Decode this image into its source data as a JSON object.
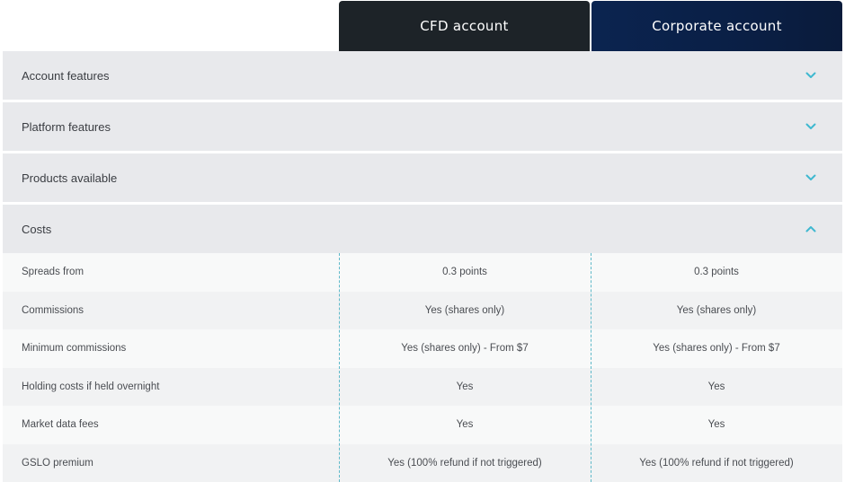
{
  "columns": [
    {
      "label": "CFD account",
      "color": "#1d2328"
    },
    {
      "label": "Corporate account",
      "color": "#0b2450"
    }
  ],
  "accent_color": "#3fb8d0",
  "sections": [
    {
      "label": "Account features",
      "expanded": false,
      "icon": "chevron-down-icon"
    },
    {
      "label": "Platform features",
      "expanded": false,
      "icon": "chevron-down-icon"
    },
    {
      "label": "Products available",
      "expanded": false,
      "icon": "chevron-down-icon"
    },
    {
      "label": "Costs",
      "expanded": true,
      "icon": "chevron-up-icon"
    }
  ],
  "costs": {
    "rows": [
      {
        "feature": "Spreads from",
        "cfd": "0.3 points",
        "corporate": "0.3 points"
      },
      {
        "feature": "Commissions",
        "cfd": "Yes (shares only)",
        "corporate": "Yes (shares only)"
      },
      {
        "feature": "Minimum commissions",
        "cfd": "Yes (shares only) - From $7",
        "corporate": "Yes (shares only) - From $7"
      },
      {
        "feature": "Holding costs if held overnight",
        "cfd": "Yes",
        "corporate": "Yes"
      },
      {
        "feature": "Market data fees",
        "cfd": "Yes",
        "corporate": "Yes"
      },
      {
        "feature": "GSLO premium",
        "cfd": "Yes (100% refund if not triggered)",
        "corporate": "Yes (100% refund if not triggered)"
      }
    ]
  }
}
